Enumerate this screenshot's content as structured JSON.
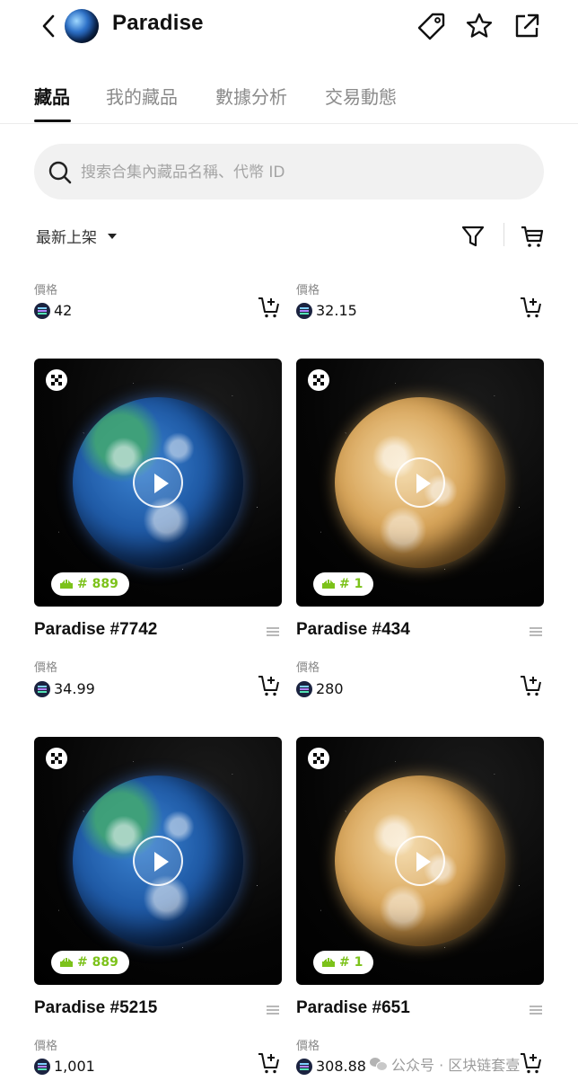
{
  "header": {
    "title": "Paradise"
  },
  "tabs": [
    {
      "label": "藏品",
      "active": true
    },
    {
      "label": "我的藏品",
      "active": false
    },
    {
      "label": "數據分析",
      "active": false
    },
    {
      "label": "交易動態",
      "active": false
    }
  ],
  "search": {
    "placeholder": "搜索合集內藏品名稱、代幣 ID"
  },
  "sort": {
    "label": "最新上架"
  },
  "top_partial_row": [
    {
      "price_label": "價格",
      "price": "42"
    },
    {
      "price_label": "價格",
      "price": "32.15"
    }
  ],
  "cards": [
    {
      "name": "Paradise #7742",
      "rank": "# 889",
      "planet": "earth",
      "price_label": "價格",
      "price": "34.99"
    },
    {
      "name": "Paradise #434",
      "rank": "# 1",
      "planet": "desert",
      "price_label": "價格",
      "price": "280"
    },
    {
      "name": "Paradise #5215",
      "rank": "# 889",
      "planet": "earth",
      "price_label": "價格",
      "price": "1,001"
    },
    {
      "name": "Paradise #651",
      "rank": "# 1",
      "planet": "desert",
      "price_label": "價格",
      "price": "308.88"
    }
  ],
  "watermark": {
    "text": "公众号 · 区块链套壹"
  }
}
